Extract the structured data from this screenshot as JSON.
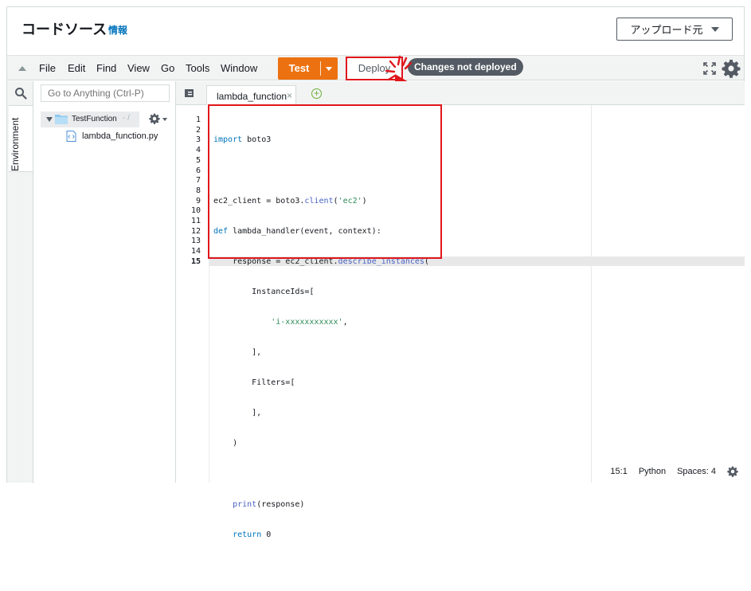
{
  "header": {
    "title": "コードソース",
    "info_link": "情報",
    "upload_button": "アップロード元"
  },
  "menu": {
    "items": [
      "File",
      "Edit",
      "Find",
      "View",
      "Go",
      "Tools",
      "Window"
    ],
    "test_label": "Test",
    "deploy_label": "Deploy",
    "status_badge": "Changes not deployed"
  },
  "sidebar": {
    "environment_tab": "Environment",
    "search_placeholder": "Go to Anything (Ctrl-P)",
    "root_folder": "TestFunction",
    "root_path": "- /",
    "file": "lambda_function.py"
  },
  "editor": {
    "tab_label": "lambda_function",
    "line_numbers": [
      "1",
      "2",
      "3",
      "4",
      "5",
      "6",
      "7",
      "8",
      "9",
      "10",
      "11",
      "12",
      "13",
      "14",
      "15"
    ],
    "code_lines": [
      "import boto3",
      "",
      "ec2_client = boto3.client('ec2')",
      "def lambda_handler(event, context):",
      "    response = ec2_client.describe_instances(",
      "        InstanceIds=[",
      "            'i-xxxxxxxxxxx',",
      "        ],",
      "        Filters=[",
      "        ],",
      "    )",
      "",
      "    print(response)",
      "    return 0",
      ""
    ]
  },
  "status_bar": {
    "cursor": "15:1",
    "language": "Python",
    "indent": "Spaces: 4"
  },
  "colors": {
    "accent_orange": "#ec7211",
    "highlight_red": "#e0161c",
    "badge_gray": "#545b64",
    "link_blue": "#0073bb"
  }
}
